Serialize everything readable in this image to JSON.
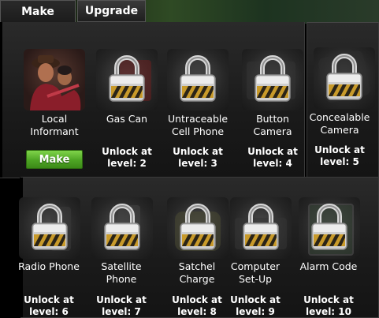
{
  "tabs": {
    "make": "Make",
    "upgrade": "Upgrade"
  },
  "make_button": "Make",
  "items": [
    {
      "name_lines": [
        "Local",
        "Informant"
      ],
      "locked": false,
      "image": "informant-portrait-icon"
    },
    {
      "name_lines": [
        "Gas Can"
      ],
      "locked": true,
      "unlock_lines": [
        "Unlock at",
        "level: 2"
      ],
      "image": "gas-can-icon"
    },
    {
      "name_lines": [
        "Untraceable",
        "Cell Phone"
      ],
      "locked": true,
      "unlock_lines": [
        "Unlock at",
        "level: 3"
      ],
      "image": "cell-phone-icon"
    },
    {
      "name_lines": [
        "Button",
        "Camera"
      ],
      "locked": true,
      "unlock_lines": [
        "Unlock at",
        "level: 4"
      ],
      "image": "button-camera-icon"
    },
    {
      "name_lines": [
        "Concealable",
        "Camera"
      ],
      "locked": true,
      "unlock_lines": [
        "Unlock at",
        "level: 5"
      ],
      "image": "concealable-camera-icon"
    },
    {
      "name_lines": [
        "Radio Phone"
      ],
      "locked": true,
      "unlock_lines": [
        "Unlock at",
        "level: 6"
      ],
      "image": "radio-phone-icon"
    },
    {
      "name_lines": [
        "Satellite",
        "Phone"
      ],
      "locked": true,
      "unlock_lines": [
        "Unlock at",
        "level: 7"
      ],
      "image": "satellite-phone-icon"
    },
    {
      "name_lines": [
        "Satchel",
        "Charge"
      ],
      "locked": true,
      "unlock_lines": [
        "Unlock at",
        "level: 8"
      ],
      "image": "satchel-charge-icon"
    },
    {
      "name_lines": [
        "Computer",
        "Set-Up"
      ],
      "locked": true,
      "unlock_lines": [
        "Unlock at",
        "level: 9"
      ],
      "image": "computer-setup-icon"
    },
    {
      "name_lines": [
        "Alarm Code"
      ],
      "locked": true,
      "unlock_lines": [
        "Unlock at",
        "level: 10"
      ],
      "image": "alarm-code-icon"
    }
  ]
}
